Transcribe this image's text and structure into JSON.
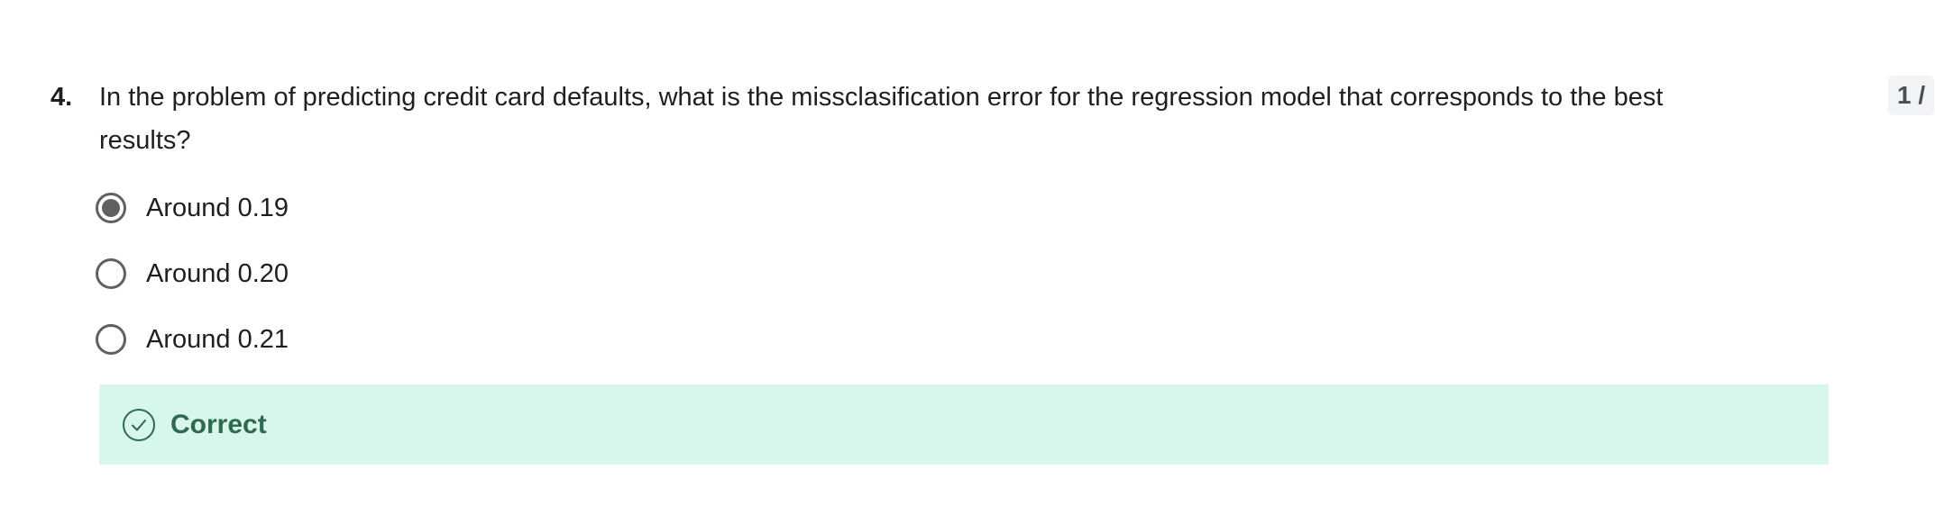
{
  "question": {
    "number": "4.",
    "text": "In the problem of predicting credit card defaults, what is the missclasification error for the regression model that corresponds to the best\nresults?"
  },
  "score": {
    "label": "1 /"
  },
  "options": [
    {
      "label": "Around 0.19",
      "selected": true
    },
    {
      "label": "Around 0.20",
      "selected": false
    },
    {
      "label": "Around 0.21",
      "selected": false
    }
  ],
  "feedback": {
    "label": "Correct",
    "icon": "check-circle-icon",
    "color": "#2d6a4f",
    "background": "#d7f7ec"
  }
}
